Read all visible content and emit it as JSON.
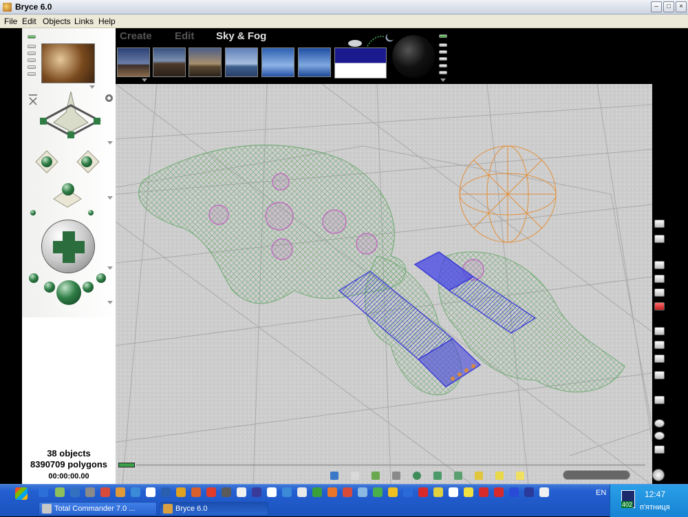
{
  "window": {
    "title": "Bryce 6.0",
    "buttons": [
      "minimize",
      "maximize",
      "close"
    ]
  },
  "menu": [
    "File",
    "Edit",
    "Objects",
    "Links",
    "Help"
  ],
  "palette": {
    "tabs": [
      {
        "label": "Create",
        "active": false
      },
      {
        "label": "Edit",
        "active": false
      },
      {
        "label": "Sky & Fog",
        "active": true
      }
    ],
    "sky_presets": [
      "desert-sky-preset",
      "mountain-sky-preset",
      "sunset-sky-preset",
      "ridge-sky-preset",
      "clear-sky-preset",
      "horizon-sky-preset"
    ],
    "color_box": {
      "top": "#1b1a8f",
      "bottom": "#ffffff"
    }
  },
  "status": {
    "objects": "38 objects",
    "polygons": "8390709 polygons",
    "time": "00:00:00.00"
  },
  "taskbar": {
    "tasks": [
      {
        "label": "Total Commander 7.0 ...",
        "icon": "total-commander-icon"
      },
      {
        "label": "Bryce 6.0",
        "icon": "bryce-icon",
        "active": true
      }
    ],
    "language": "EN",
    "clock": "12:47",
    "day": "п'ятниця",
    "tray_badge": "402"
  },
  "colors": {
    "terrain_wire": "#6aa86e",
    "box_wire": "#3b3bd6",
    "sphere_wire": "#e48a2c",
    "magenta_wire": "#c060c0"
  }
}
